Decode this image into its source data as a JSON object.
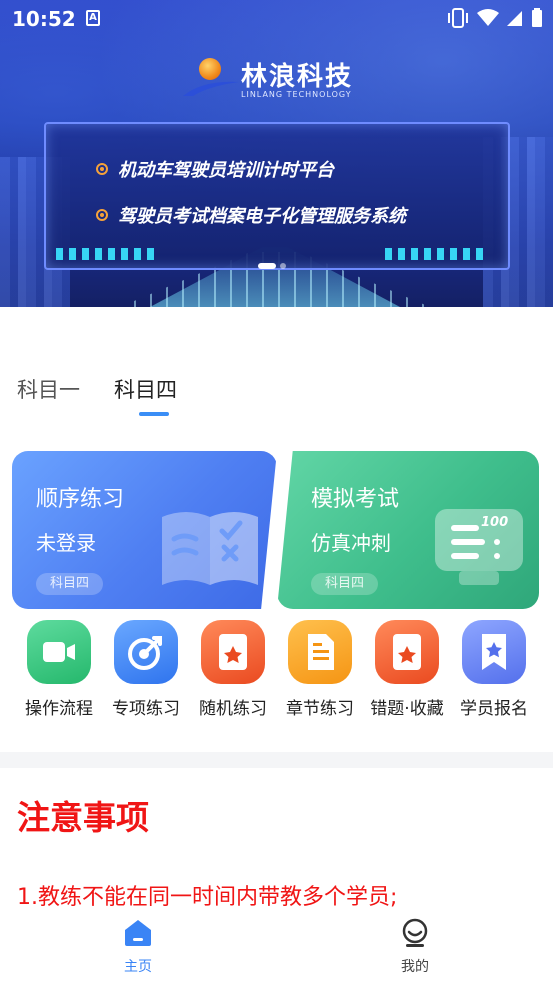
{
  "status_bar": {
    "time": "10:52",
    "notif_letter": "A"
  },
  "banner": {
    "logo_title": "林浪科技",
    "logo_subtitle": "LINLANG TECHNOLOGY",
    "lines": [
      "机动车驾驶员培训计时平台",
      "驾驶员考试档案电子化管理服务系统"
    ],
    "slide_count": 2,
    "active_slide": 1
  },
  "tabs": [
    {
      "label": "科目一",
      "active": false
    },
    {
      "label": "科目四",
      "active": true
    }
  ],
  "cards": [
    {
      "title": "顺序练习",
      "subtitle": "未登录",
      "tag": "科目四",
      "color": "#4f7ff2"
    },
    {
      "title": "模拟考试",
      "subtitle": "仿真冲刺",
      "tag": "科目四",
      "color": "#3fbe8c"
    }
  ],
  "grid": [
    {
      "label": "操作流程",
      "icon": "video-camera-icon",
      "color": "#2fc27a"
    },
    {
      "label": "专项练习",
      "icon": "target-icon",
      "color": "#3a84f5"
    },
    {
      "label": "随机练习",
      "icon": "star-card-icon",
      "color": "#f0582f"
    },
    {
      "label": "章节练习",
      "icon": "document-icon",
      "color": "#f8a11c"
    },
    {
      "label": "错题·收藏",
      "icon": "star-card-icon",
      "color": "#f0582f"
    },
    {
      "label": "学员报名",
      "icon": "bookmark-star-icon",
      "color": "#5a7cf0"
    }
  ],
  "notice": {
    "title": "注意事项",
    "items": [
      "1.教练不能在同一时间内带教多个学员;"
    ]
  },
  "bottom_nav": [
    {
      "label": "主页",
      "icon": "home-icon",
      "active": true,
      "color": "#3a84f5"
    },
    {
      "label": "我的",
      "icon": "smile-face-icon",
      "active": false,
      "color": "#444444"
    }
  ]
}
